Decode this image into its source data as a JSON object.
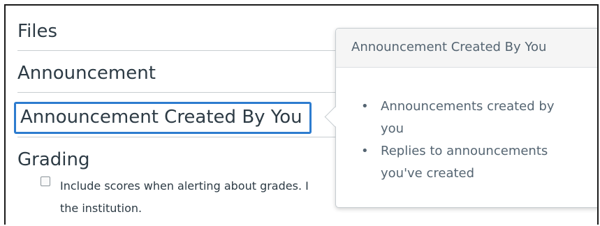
{
  "rows": {
    "files": "Files",
    "announcement": "Announcement",
    "announcement_you": "Announcement Created By You",
    "grading": "Grading"
  },
  "checkbox": {
    "line1": "Include scores when alerting about grades. I",
    "line2": "the institution."
  },
  "popover": {
    "title": "Announcement Created By You",
    "items": [
      "Announcements created by you",
      "Replies to announcements you've created"
    ]
  },
  "colors": {
    "focus_ring": "#2d7ccf",
    "text": "#2d3b45",
    "muted": "#556572"
  }
}
